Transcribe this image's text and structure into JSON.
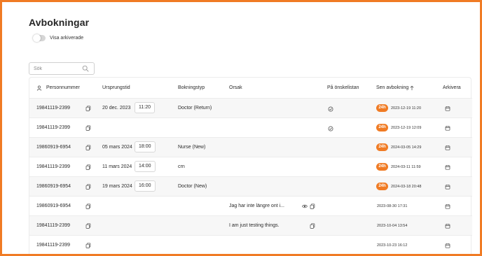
{
  "page": {
    "title": "Avbokningar"
  },
  "toggle": {
    "label": "Visa arkiverade",
    "on": false
  },
  "search": {
    "placeholder": "Sök"
  },
  "colors": {
    "accent": "#f07b24",
    "border": "#ececec"
  },
  "columns": {
    "personnummer": "Personnummer",
    "ursprungstid": "Ursprungstid",
    "bokningstyp": "Bokningstyp",
    "orsak": "Orsak",
    "onskelistan": "På önskelistan",
    "sen_avbokning": "Sen avbokning",
    "arkivera": "Arkivera"
  },
  "sort": {
    "column": "sen_avbokning",
    "direction": "ascending",
    "icon": "arrow-up-icon"
  },
  "rows": [
    {
      "personnummer": "19841119-2399",
      "date": "20 dec. 2023",
      "time": "11:20",
      "type": "Doctor (Return)",
      "reason": "",
      "wishlist": true,
      "late_badge": "24h",
      "timestamp": "2023-12-19 11:20"
    },
    {
      "personnummer": "19841119-2399",
      "date": "",
      "time": "",
      "type": "",
      "reason": "",
      "wishlist": true,
      "late_badge": "24h",
      "timestamp": "2023-12-19 12:09"
    },
    {
      "personnummer": "19860919-6954",
      "date": "05 mars 2024",
      "time": "18:00",
      "type": "Nurse (New)",
      "reason": "",
      "wishlist": false,
      "late_badge": "24h",
      "timestamp": "2024-03-05 14:29"
    },
    {
      "personnummer": "19841119-2399",
      "date": "11 mars 2024",
      "time": "14:00",
      "type": "crn",
      "reason": "",
      "wishlist": false,
      "late_badge": "24h",
      "timestamp": "2024-03-11 11:59"
    },
    {
      "personnummer": "19860919-6954",
      "date": "19 mars 2024",
      "time": "16:00",
      "type": "Doctor (New)",
      "reason": "",
      "wishlist": false,
      "late_badge": "24h",
      "timestamp": "2024-03-18 20:48"
    },
    {
      "personnummer": "19860919-6954",
      "date": "",
      "time": "",
      "type": "",
      "reason": "Jag har inte längre ont i...",
      "wishlist": false,
      "late_badge": "",
      "timestamp": "2023-08-30 17:31"
    },
    {
      "personnummer": "19841119-2399",
      "date": "",
      "time": "",
      "type": "",
      "reason": "I am just testing things.",
      "wishlist": false,
      "late_badge": "",
      "timestamp": "2023-10-04 13:54"
    },
    {
      "personnummer": "19841119-2399",
      "date": "",
      "time": "",
      "type": "",
      "reason": "",
      "wishlist": false,
      "late_badge": "",
      "timestamp": "2023-10-23 16:12"
    }
  ]
}
